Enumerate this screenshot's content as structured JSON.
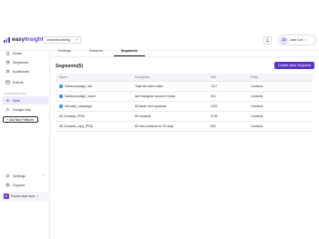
{
  "header": {
    "logo_text_a": "easy",
    "logo_text_b": "Insights",
    "workspace": "Unnamed listing",
    "user_initials": "JD",
    "user_name": "Jane Doe"
  },
  "sidebar": {
    "items": [
      {
        "label": "Home",
        "icon": "home-icon"
      },
      {
        "label": "Segments",
        "icon": "segments-icon"
      },
      {
        "label": "Audiences",
        "icon": "audiences-icon"
      },
      {
        "label": "Events",
        "icon": "events-icon"
      }
    ],
    "section_label": "INTEGRATIONS",
    "integrations": [
      {
        "label": "Klikk",
        "icon": "klikk-icon"
      },
      {
        "label": "Google Ads",
        "icon": "google-ads-icon"
      }
    ],
    "add_platform": "+ Add New Platform",
    "settings": "Settings",
    "support": "Support",
    "store_initial": "P",
    "store_name": "Pioneer style store"
  },
  "tabs": [
    "Settings",
    "Datasets",
    "Segments"
  ],
  "active_tab": "Segments",
  "main": {
    "heading": "Segments(5)",
    "create_button": "Create New Segment"
  },
  "table": {
    "headers": [
      "Name",
      "Description",
      "Size",
      "Entity"
    ],
    "rows": [
      {
        "name": "Salescampaign_fab",
        "description": "Total fab sales make",
        "size": "1217",
        "entity": "Contacts",
        "icon": true
      },
      {
        "name": "Salescampaign_insom",
        "description": "last instagram account media",
        "size": "314",
        "entity": "Contacts",
        "icon": true
      },
      {
        "name": "AllLeads_campaign",
        "description": "All leads from cpadons",
        "size": "1302",
        "entity": "Contacts",
        "icon": true
      },
      {
        "name": "All Contacts_PRIU",
        "description": "All contacts",
        "size": "3746",
        "entity": "Contacts",
        "icon": false
      },
      {
        "name": "All Contacts_copy_PRIU",
        "description": "All new contacts for 29 days",
        "size": "632",
        "entity": "Contacts",
        "icon": false
      }
    ]
  },
  "colors": {
    "brand": "#6a3fd8",
    "button": "#5b35c8",
    "active_bg": "#efe9fd"
  }
}
